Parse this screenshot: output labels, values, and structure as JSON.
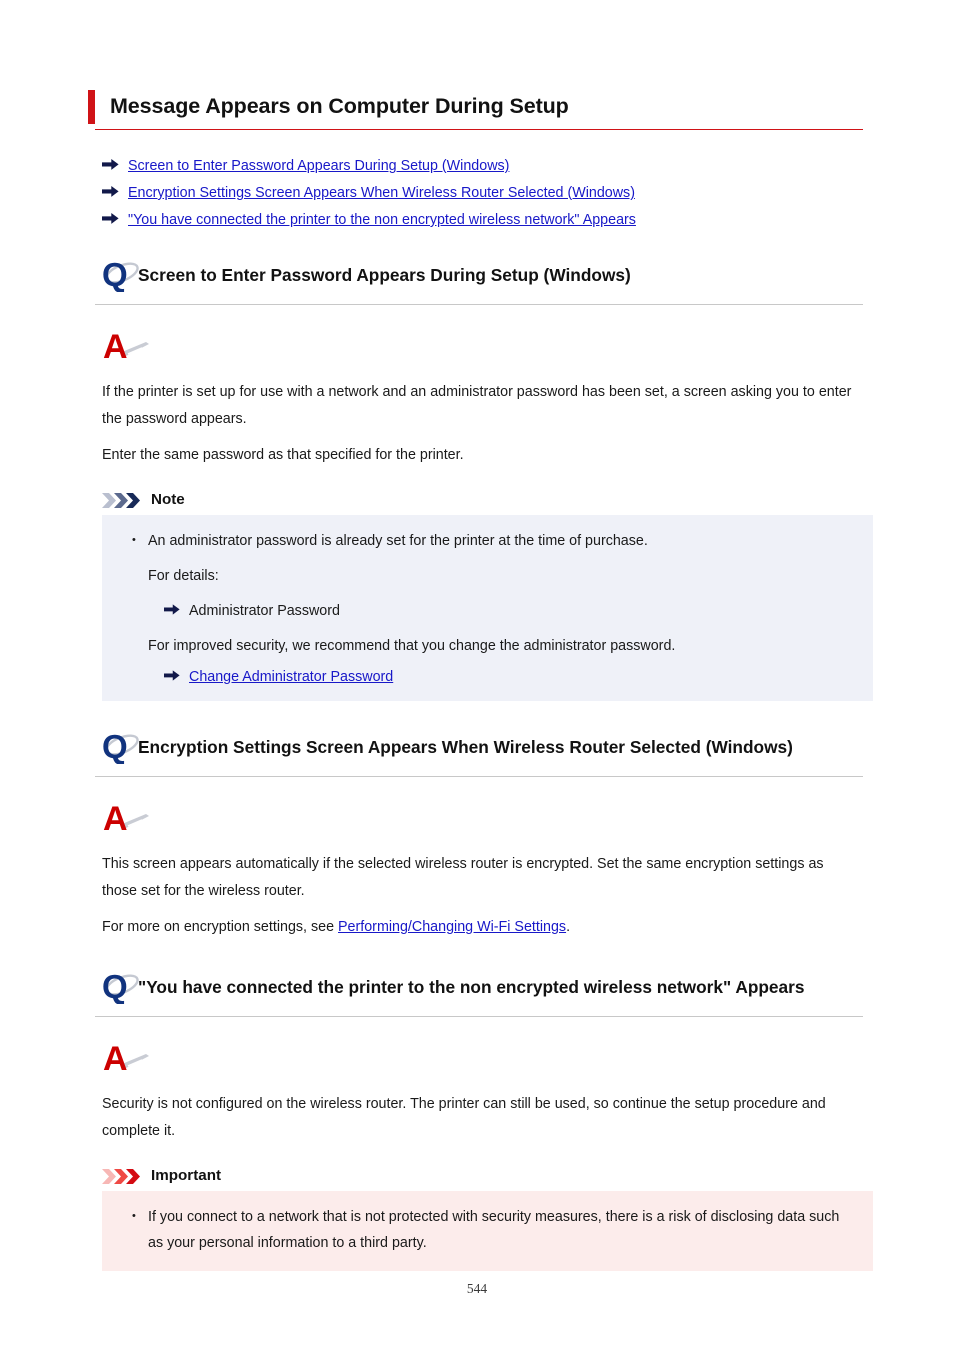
{
  "document": {
    "title": "Message Appears on Computer During Setup",
    "page_number": "544",
    "accent_color": "#d01317",
    "link_color": "#1818c8"
  },
  "toc_links": [
    {
      "label": "Screen to Enter Password Appears During Setup (Windows)",
      "icon": "arrow-right-icon"
    },
    {
      "label": "Encryption Settings Screen Appears When Wireless Router Selected (Windows)",
      "icon": "arrow-right-icon"
    },
    {
      "label": "\"You have connected the printer to the non encrypted wireless network\" Appears",
      "icon": "arrow-right-icon"
    }
  ],
  "sections": [
    {
      "question_icon": "question-q-icon",
      "question": "Screen to Enter Password Appears During Setup (Windows)",
      "answer_icon": "answer-a-icon",
      "paragraphs": [
        "If the printer is set up for use with a network and an administrator password has been set, a screen asking you to enter the password appears.",
        "Enter the same password as that specified for the printer."
      ],
      "callout": {
        "type": "note",
        "icon": "chevrons-note-icon",
        "label": "Note",
        "background": "#eff1f8",
        "bullet": "An administrator password is already set for the printer at the time of purchase.",
        "detail_intro": "For details:",
        "detail_ref": "Administrator Password",
        "security_note": "For improved security, we recommend that you change the administrator password.",
        "detail_link": "Change Administrator Password"
      }
    },
    {
      "question_icon": "question-q-icon",
      "question": "Encryption Settings Screen Appears When Wireless Router Selected (Windows)",
      "answer_icon": "answer-a-icon",
      "paragraphs": [
        "This screen appears automatically if the selected wireless router is encrypted. Set the same encryption settings as those set for the wireless router."
      ],
      "link_paragraph": {
        "prefix": "For more on encryption settings, see ",
        "link": "Performing/Changing Wi-Fi Settings",
        "suffix": "."
      }
    },
    {
      "question_icon": "question-q-icon",
      "question": "\"You have connected the printer to the non encrypted wireless network\" Appears",
      "answer_icon": "answer-a-icon",
      "paragraphs": [
        "Security is not configured on the wireless router. The printer can still be used, so continue the setup procedure and complete it."
      ],
      "callout": {
        "type": "important",
        "icon": "chevrons-important-icon",
        "label": "Important",
        "background": "#fceceb",
        "bullet": "If you connect to a network that is not protected with security measures, there is a risk of disclosing data such as your personal information to a third party."
      }
    }
  ]
}
